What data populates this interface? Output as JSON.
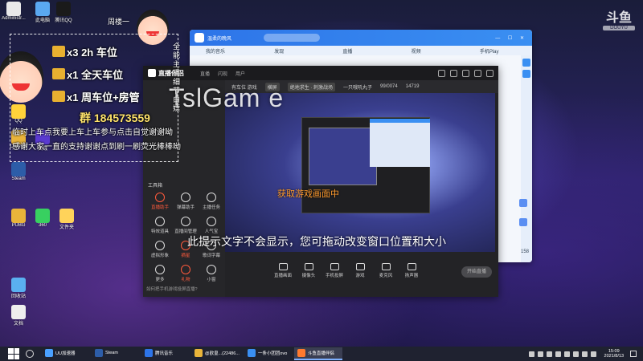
{
  "desktop": {
    "icons": [
      {
        "label": "Administr...",
        "color": "#e9e9e9"
      },
      {
        "label": "此电脑",
        "color": "#5aa8f0"
      },
      {
        "label": "腾讯QQ",
        "color": "#1a1a1a"
      },
      {
        "label": "QQ",
        "color": "#ffd23a"
      },
      {
        "label": "Chrome",
        "color": "#e9b43a"
      },
      {
        "label": "火绒",
        "color": "#5a3ad0"
      },
      {
        "label": "Steam",
        "color": "#2d5da8"
      },
      {
        "label": "PUBG",
        "color": "#e9b43a"
      },
      {
        "label": "360",
        "color": "#38d060"
      },
      {
        "label": "文件夹",
        "color": "#ffd35a"
      },
      {
        "label": "回收站",
        "color": "#5ab0f0"
      },
      {
        "label": "文档",
        "color": "#eeeeee"
      }
    ]
  },
  "sticker": {
    "name_tag": "周楼一",
    "rows": [
      "x3  2h 车位",
      "x1  全天车位",
      "x1  周车位+房管"
    ],
    "qq": "群 184573559",
    "line1": "临时上车点我要上车上车参与点击自觉谢谢呦",
    "line2": "感谢大家一直的支持谢谢点到刷一刷荧光棒棒呦",
    "vertical": "全能主播·细节白嫖"
  },
  "music": {
    "title": "温柔的晚风",
    "tabs": [
      "我的音乐",
      "发现",
      "直播",
      "视频",
      "手机Play"
    ],
    "count": "158"
  },
  "live": {
    "app_name": "直播伴侣",
    "top_tabs": [
      "直播",
      "闪现",
      "用户"
    ],
    "preview_tabs": [
      "有车位 游戏",
      "横屏"
    ],
    "preview_info": [
      "绝地求生 · 刺激战场",
      "一只哦吼丸子",
      "99/0074",
      "14719"
    ],
    "section": "工具箱",
    "tools": [
      {
        "label": "直播助手",
        "red": true
      },
      {
        "label": "弹幕助手",
        "red": false
      },
      {
        "label": "主播任务",
        "red": false
      },
      {
        "label": "特效道具",
        "red": false
      },
      {
        "label": "直播间管理",
        "red": false
      },
      {
        "label": "人气宝",
        "red": false
      },
      {
        "label": "虚拟形象",
        "red": false
      },
      {
        "label": "摘星",
        "red": true
      },
      {
        "label": "歌词字幕",
        "red": false
      },
      {
        "label": "更多",
        "red": false
      },
      {
        "label": "礼物",
        "red": true
      },
      {
        "label": "小窗",
        "red": false
      }
    ],
    "footer": "如何把手机游戏投屏直播?",
    "controls": [
      "直播画面",
      "摄像头",
      "手机投屏",
      "游戏",
      "麦克风",
      "扬声器"
    ],
    "go_live": "开始直播",
    "overlay_title": "TslGam e",
    "overlay_sub": "获取游戏画面中",
    "overlay_hint": "此提示文字不会显示，您可拖动改变窗口位置和大小"
  },
  "douyu": {
    "big": "斗鱼",
    "small": "DOUYU"
  },
  "taskbar": {
    "items": [
      {
        "label": "UU加速器",
        "color": "#4aa0ff",
        "active": false
      },
      {
        "label": "Steam",
        "color": "#2d5da8",
        "active": false
      },
      {
        "label": "腾讯音乐",
        "color": "#2d74e8",
        "active": false
      },
      {
        "label": "@欧皇...(22486...",
        "color": "#e9b43a",
        "active": false
      },
      {
        "label": "一条小团团ovo",
        "color": "#3a8ff2",
        "active": false
      },
      {
        "label": "斗鱼直播伴侣",
        "color": "#ff7a2e",
        "active": true
      }
    ],
    "time": "15:09",
    "date": "2021/8/13"
  }
}
